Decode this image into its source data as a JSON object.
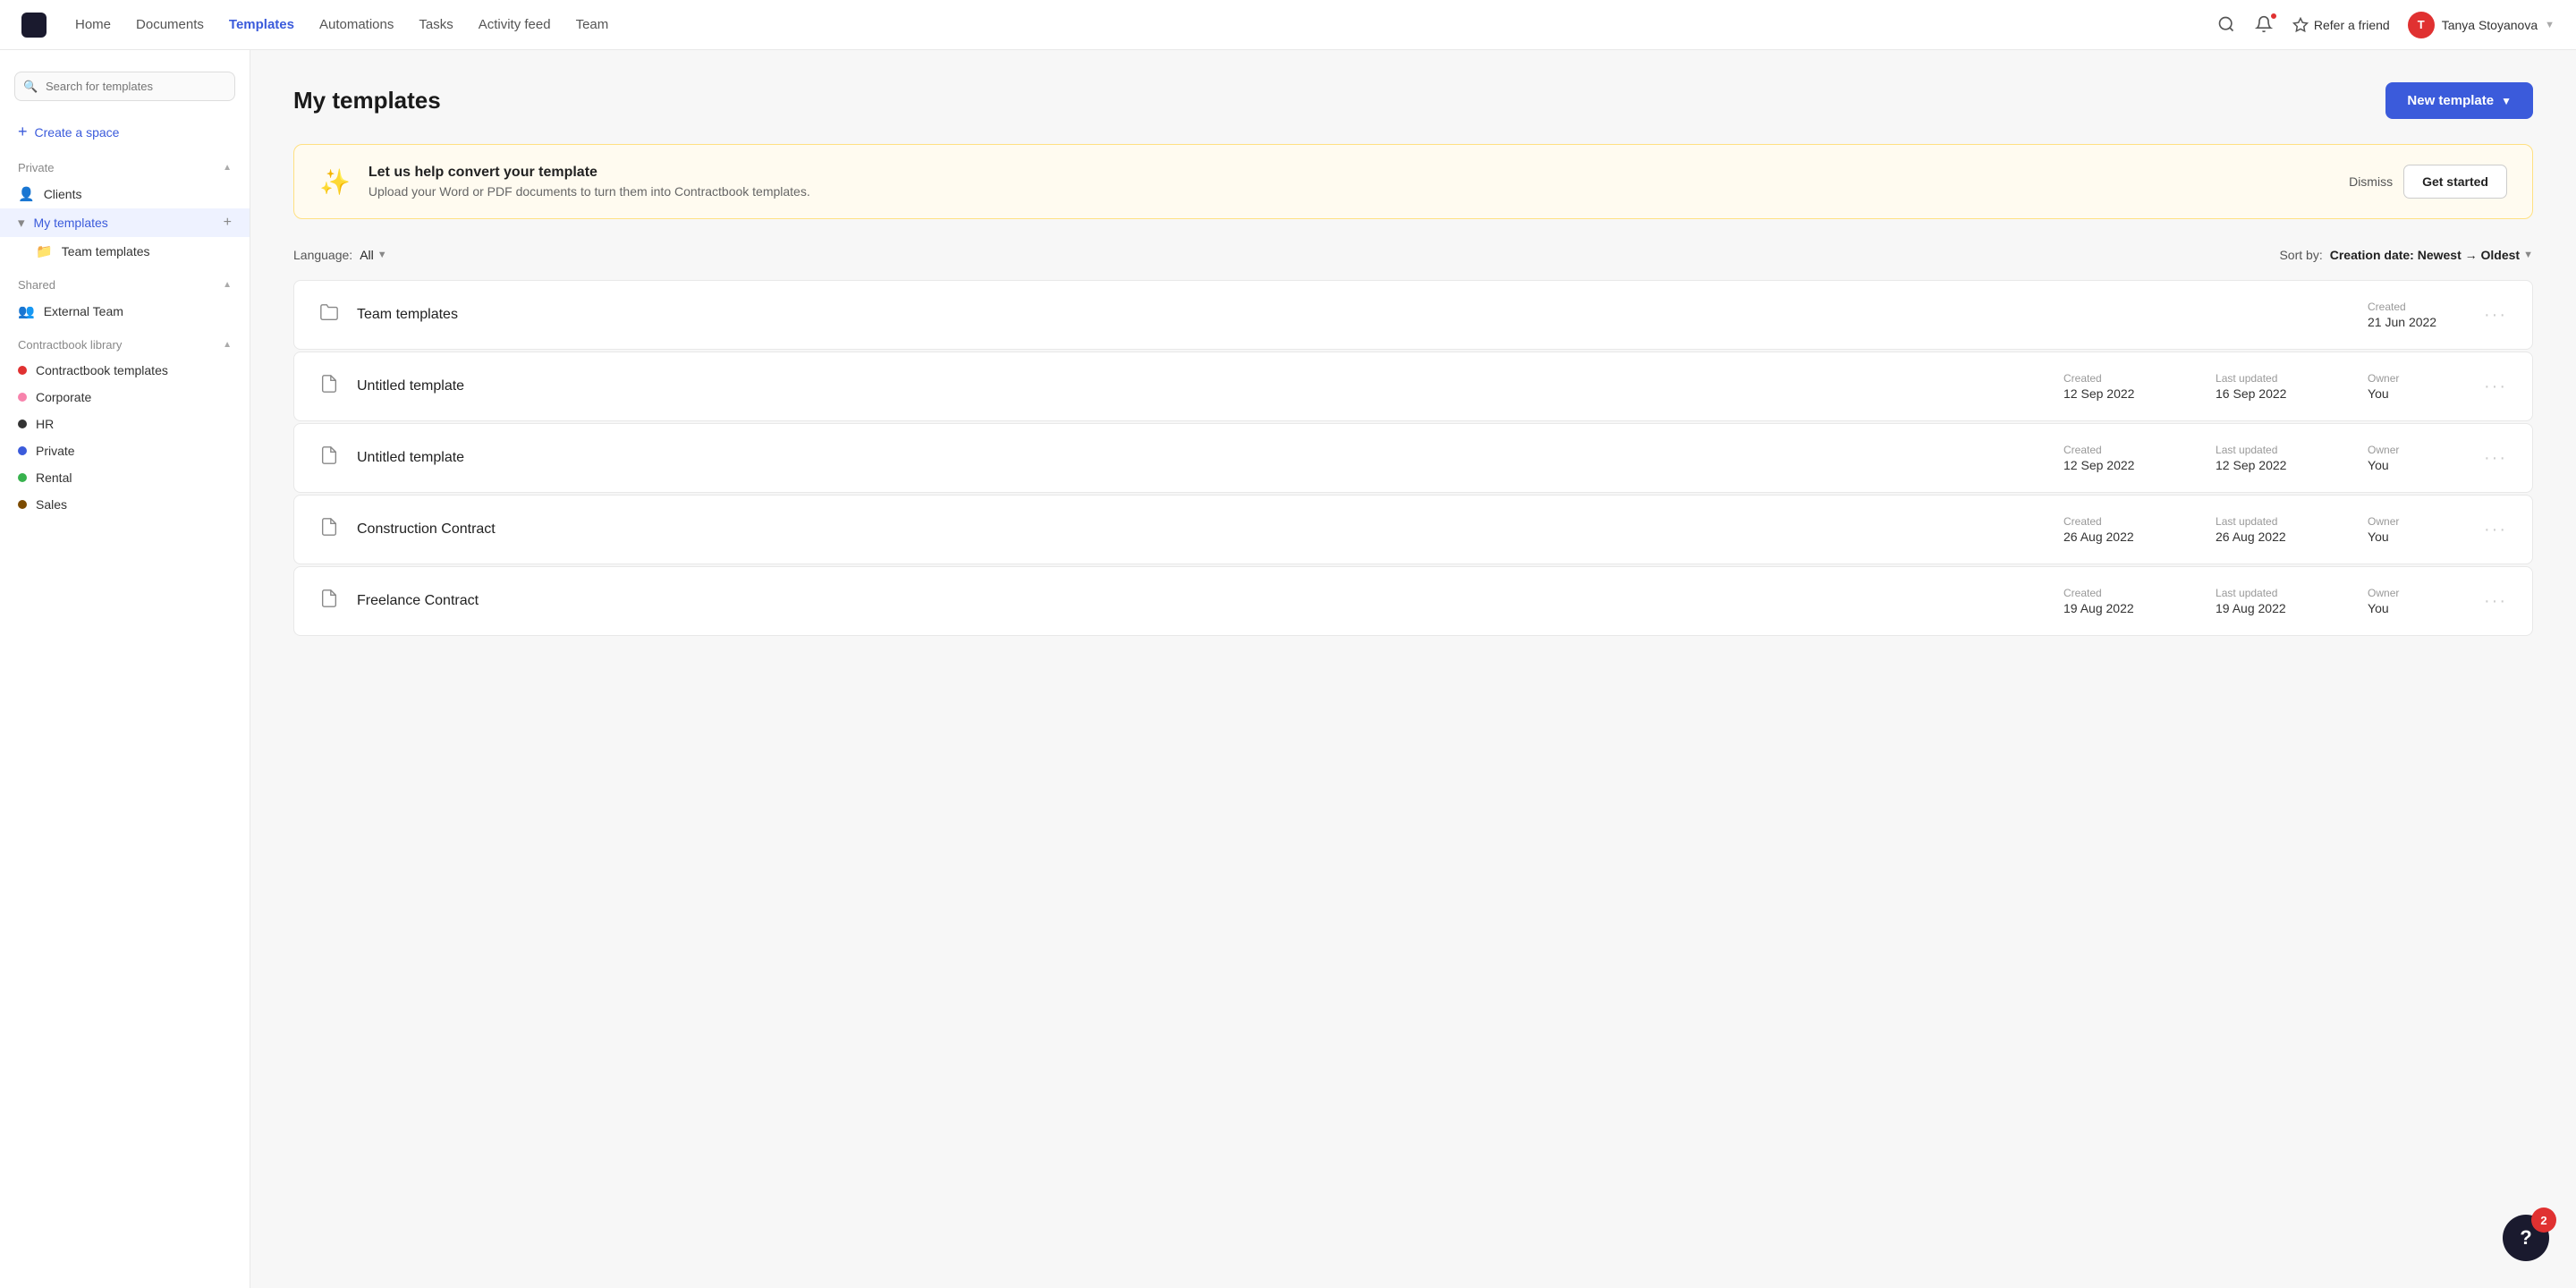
{
  "nav": {
    "links": [
      {
        "id": "home",
        "label": "Home",
        "active": false
      },
      {
        "id": "documents",
        "label": "Documents",
        "active": false
      },
      {
        "id": "templates",
        "label": "Templates",
        "active": true
      },
      {
        "id": "automations",
        "label": "Automations",
        "active": false
      },
      {
        "id": "tasks",
        "label": "Tasks",
        "active": false
      },
      {
        "id": "activity-feed",
        "label": "Activity feed",
        "active": false
      },
      {
        "id": "team",
        "label": "Team",
        "active": false
      }
    ],
    "refer_label": "Refer a friend",
    "user_name": "Tanya Stoyanova",
    "user_initials": "T"
  },
  "sidebar": {
    "search_placeholder": "Search for templates",
    "create_space_label": "Create a space",
    "sections": [
      {
        "id": "private",
        "label": "Private",
        "items": [
          {
            "id": "clients",
            "label": "Clients",
            "icon": "person"
          },
          {
            "id": "my-templates",
            "label": "My templates",
            "active": true
          },
          {
            "id": "team-templates-sub",
            "label": "Team templates",
            "indent": true
          }
        ]
      },
      {
        "id": "shared",
        "label": "Shared",
        "items": [
          {
            "id": "external-team",
            "label": "External Team",
            "icon": "group"
          }
        ]
      },
      {
        "id": "contractbook-library",
        "label": "Contractbook library",
        "items": [
          {
            "id": "contractbook-templates",
            "label": "Contractbook templates",
            "dot": "red"
          },
          {
            "id": "corporate",
            "label": "Corporate",
            "dot": "pink"
          },
          {
            "id": "hr",
            "label": "HR",
            "dot": "dark"
          },
          {
            "id": "private-lib",
            "label": "Private",
            "dot": "blue"
          },
          {
            "id": "rental",
            "label": "Rental",
            "dot": "green"
          },
          {
            "id": "sales",
            "label": "Sales",
            "dot": "brown"
          }
        ]
      }
    ]
  },
  "main": {
    "page_title": "My templates",
    "new_template_btn": "New template",
    "banner": {
      "title": "Let us help convert your template",
      "subtitle": "Upload your Word or PDF documents to turn them into Contractbook templates.",
      "dismiss_label": "Dismiss",
      "get_started_label": "Get started"
    },
    "filters": {
      "language_label": "Language:",
      "language_value": "All",
      "sort_label": "Sort by:",
      "sort_value": "Creation date: Newest → Oldest"
    },
    "templates": [
      {
        "id": "team-templates",
        "name": "Team templates",
        "is_folder": true,
        "created_label": "Created",
        "created": "21 Jun 2022",
        "last_updated_label": null,
        "last_updated": null,
        "owner_label": null,
        "owner": null
      },
      {
        "id": "untitled-1",
        "name": "Untitled template",
        "is_folder": false,
        "created_label": "Created",
        "created": "12 Sep 2022",
        "last_updated_label": "Last updated",
        "last_updated": "16 Sep 2022",
        "owner_label": "Owner",
        "owner": "You"
      },
      {
        "id": "untitled-2",
        "name": "Untitled template",
        "is_folder": false,
        "created_label": "Created",
        "created": "12 Sep 2022",
        "last_updated_label": "Last updated",
        "last_updated": "12 Sep 2022",
        "owner_label": "Owner",
        "owner": "You"
      },
      {
        "id": "construction",
        "name": "Construction Contract",
        "is_folder": false,
        "created_label": "Created",
        "created": "26 Aug 2022",
        "last_updated_label": "Last updated",
        "last_updated": "26 Aug 2022",
        "owner_label": "Owner",
        "owner": "You"
      },
      {
        "id": "freelance",
        "name": "Freelance Contract",
        "is_folder": false,
        "created_label": "Created",
        "created": "19 Aug 2022",
        "last_updated_label": "Last updated",
        "last_updated": "19 Aug 2022",
        "owner_label": "Owner",
        "owner": "You"
      }
    ],
    "help_badge_count": "2",
    "help_label": "?"
  }
}
